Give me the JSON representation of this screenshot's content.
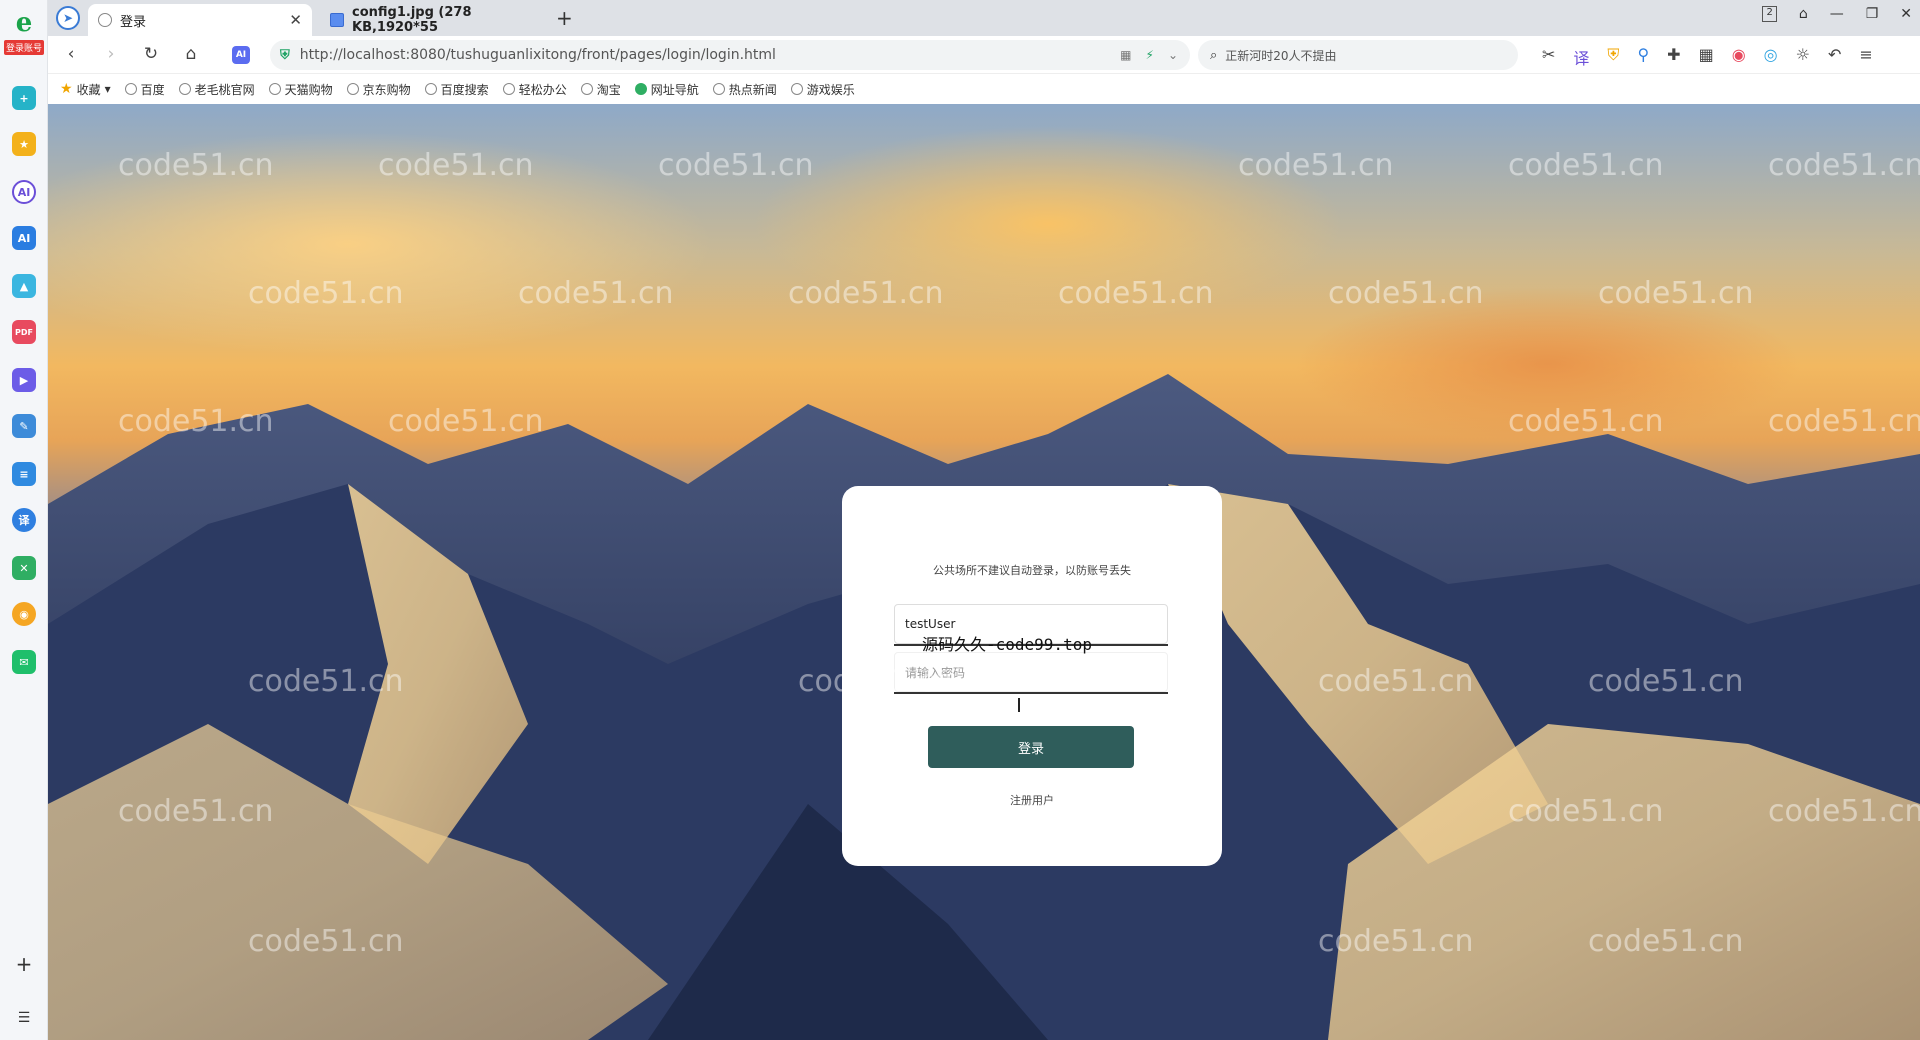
{
  "browser": {
    "left_strip": {
      "login_badge": "登录账号",
      "icons": [
        "plus-icon",
        "star-icon",
        "ai-icon",
        "ai-text-icon",
        "picture-icon",
        "pdf-icon",
        "video-icon",
        "edit-icon",
        "doc-icon",
        "translate-icon",
        "map-icon",
        "weibo-icon",
        "mail-icon"
      ],
      "pdf_label": "PDF",
      "ai_label": "AI"
    },
    "tabs": [
      {
        "title": "登录",
        "active": true
      },
      {
        "title": "config1.jpg (278 KB,1920*55",
        "active": false
      }
    ],
    "window_controls": {
      "badge": "2"
    },
    "address": {
      "url": "http://localhost:8080/tushuguanlixitong/front/pages/login/login.html",
      "ai_button": "AI"
    },
    "search": {
      "text": "正新河时20人不提由"
    },
    "bookmarks": [
      {
        "label": "收藏"
      },
      {
        "label": "百度"
      },
      {
        "label": "老毛桃官网"
      },
      {
        "label": "天猫购物"
      },
      {
        "label": "京东购物"
      },
      {
        "label": "百度搜索"
      },
      {
        "label": "轻松办公"
      },
      {
        "label": "淘宝"
      },
      {
        "label": "网址导航"
      },
      {
        "label": "热点新闻"
      },
      {
        "label": "游戏娱乐"
      }
    ]
  },
  "watermark": "code51.cn",
  "login": {
    "tip": "公共场所不建议自动登录，以防账号丢失",
    "username_value": "testUser",
    "username_overlay": "源码久久-code99.top",
    "password_placeholder": "请输入密码",
    "login_button": "登录",
    "register_link": "注册用户"
  }
}
